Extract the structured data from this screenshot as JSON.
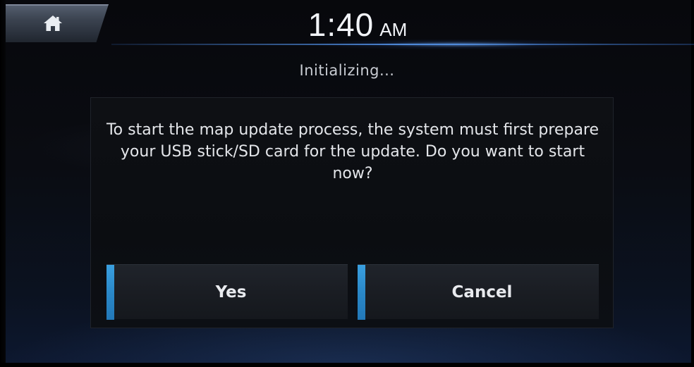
{
  "status_bar": {
    "home_icon": "home-icon",
    "time": "1:40",
    "ampm": "AM"
  },
  "status_text": "Initializing...",
  "dialog": {
    "message": "To start the map update process, the system must first prepare your USB stick/SD card for the update. Do you want to start now?",
    "yes_label": "Yes",
    "cancel_label": "Cancel"
  },
  "colors": {
    "button_accent": "#2a88c8",
    "text_primary": "#e4e6ea",
    "clock_glow": "#5aa0ff"
  }
}
